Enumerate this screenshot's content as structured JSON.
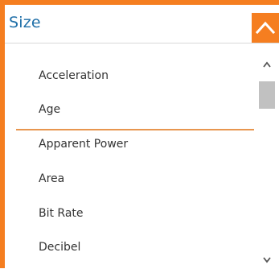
{
  "header": {
    "title": "Size",
    "collapse_icon": "chevron-up-icon"
  },
  "list": {
    "items": [
      {
        "label": "Acceleration"
      },
      {
        "label": "Age"
      },
      {
        "label": "Apparent Power"
      },
      {
        "label": "Area"
      },
      {
        "label": "Bit Rate"
      },
      {
        "label": "Decibel"
      }
    ]
  },
  "scrollbar": {
    "up_icon": "chevron-up-icon",
    "down_icon": "chevron-down-icon"
  },
  "colors": {
    "accent": "#f57e20",
    "title": "#1f6fa8",
    "divider": "#e8964f",
    "thumb": "#c1c1c1"
  }
}
